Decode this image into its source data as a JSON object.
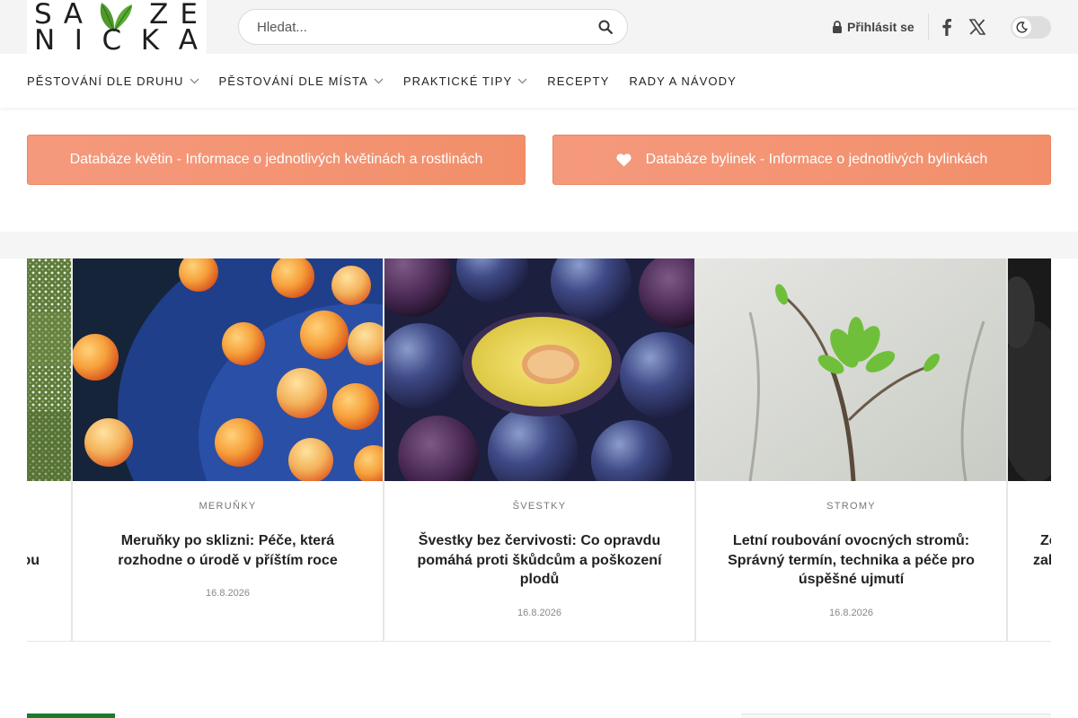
{
  "brand": {
    "logo_line1": [
      "S",
      "A",
      "Z",
      "E"
    ],
    "logo_line2": [
      "N",
      "I",
      "C",
      "K",
      "A"
    ],
    "accent_green": "#4f9a2b"
  },
  "header": {
    "search_placeholder": "Hledat...",
    "login_label": "Přihlásit se",
    "icons": [
      "search-icon",
      "lock-icon",
      "facebook-icon",
      "x-icon",
      "moon-icon"
    ]
  },
  "nav": {
    "items": [
      {
        "label": "PĚSTOVÁNÍ DLE DRUHU",
        "dropdown": true
      },
      {
        "label": "PĚSTOVÁNÍ DLE MÍSTA",
        "dropdown": true
      },
      {
        "label": "PRAKTICKÉ TIPY",
        "dropdown": true
      },
      {
        "label": "RECEPTY",
        "dropdown": false
      },
      {
        "label": "RADY A NÁVODY",
        "dropdown": false
      }
    ]
  },
  "database_buttons": [
    {
      "label": "Databáze květin - Informace o jednotlivých květinách a rostlinách"
    },
    {
      "label": "Databáze bylinek - Informace o jednotlivých bylinkách",
      "icon": "heart-icon"
    }
  ],
  "carousel": {
    "partial_left": {
      "title_fragment": "ou"
    },
    "cards": [
      {
        "category": "MERUŇKY",
        "title": "Meruňky po sklizni: Péče, která rozhodne o úrodě v příštím roce",
        "date": "16.8.2026"
      },
      {
        "category": "ŠVESTKY",
        "title": "Švestky bez červivosti: Co opravdu pomáhá proti škůdcům a poškození plodů",
        "date": "16.8.2026"
      },
      {
        "category": "STROMY",
        "title": "Letní roubování ovocných stromů: Správný termín, technika a péče pro úspěšné ujmutí",
        "date": "16.8.2026"
      }
    ],
    "partial_right": {
      "title_fragment_1": "Ze",
      "title_fragment_2": "zal"
    }
  },
  "colors": {
    "button_orange": "#f2926d",
    "topbar_bg": "#f4f4f4"
  }
}
